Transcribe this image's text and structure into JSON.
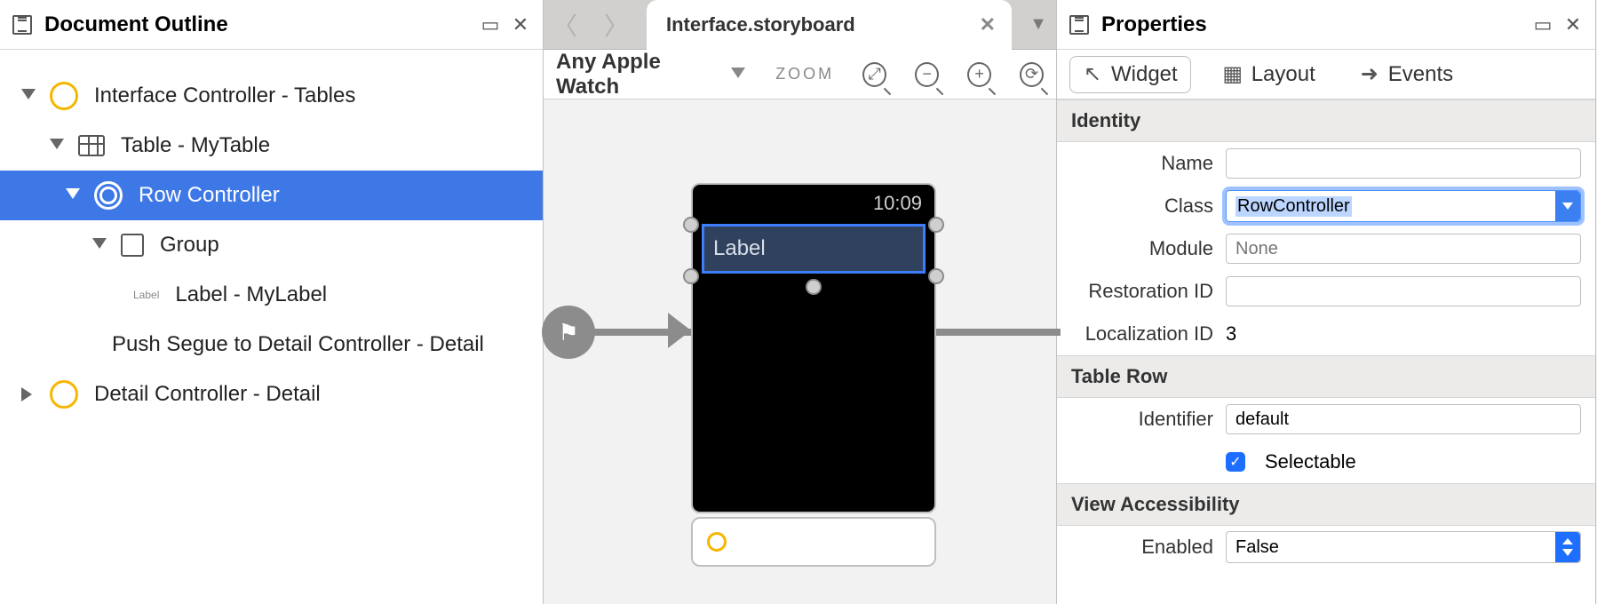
{
  "outline": {
    "title": "Document Outline",
    "items": {
      "root": "Interface Controller - Tables",
      "table": "Table - MyTable",
      "row": "Row Controller",
      "group": "Group",
      "label": "Label - MyLabel",
      "segue": "Push Segue to Detail Controller - Detail",
      "detail": "Detail Controller - Detail"
    }
  },
  "canvas": {
    "tab": "Interface.storyboard",
    "device": "Any Apple Watch",
    "zoom_label": "ZOOM",
    "watch_time": "10:09",
    "row_label": "Label"
  },
  "properties": {
    "title": "Properties",
    "tabs": {
      "widget": "Widget",
      "layout": "Layout",
      "events": "Events"
    },
    "sections": {
      "identity": "Identity",
      "table_row": "Table Row",
      "view_acc": "View Accessibility"
    },
    "labels": {
      "name": "Name",
      "class": "Class",
      "module": "Module",
      "restoration_id": "Restoration ID",
      "localization_id": "Localization ID",
      "identifier": "Identifier",
      "selectable": "Selectable",
      "enabled": "Enabled"
    },
    "values": {
      "name": "",
      "class": "RowController",
      "module_placeholder": "None",
      "restoration_id": "",
      "localization_id": "3",
      "identifier": "default",
      "selectable_checked": true,
      "enabled": "False"
    }
  }
}
